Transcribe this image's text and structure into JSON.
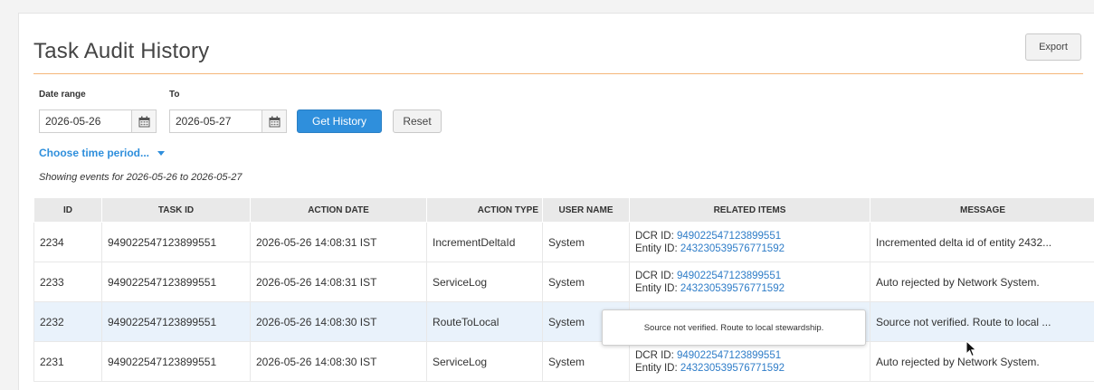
{
  "header": {
    "title": "Task Audit History",
    "export_label": "Export"
  },
  "filters": {
    "date_range_label": "Date range",
    "to_label": "To",
    "from_value": "2026-05-26",
    "to_value": "2026-05-27",
    "calendar_icon": "calendar-icon",
    "get_history_label": "Get History",
    "reset_label": "Reset",
    "choose_period_label": "Choose time period...",
    "showing_text": "Showing events for 2026-05-26 to 2026-05-27"
  },
  "colors": {
    "accent": "#2f8fdc",
    "rule": "#f5b77a",
    "highlight_row": "#e9f2fb"
  },
  "table": {
    "columns": [
      "ID",
      "TASK ID",
      "ACTION DATE",
      "ACTION TYPE",
      "USER NAME",
      "RELATED ITEMS",
      "MESSAGE"
    ],
    "rows": [
      {
        "id": "2234",
        "task_id": "949022547123899551",
        "action_date": "2026-05-26 14:08:31 IST",
        "action_type": "IncrementDeltaId",
        "user": "System",
        "dcr_label": "DCR ID: ",
        "dcr": "949022547123899551",
        "entity_label": "Entity ID: ",
        "entity": "243230539576771592",
        "message": "Incremented delta id of entity 2432..."
      },
      {
        "id": "2233",
        "task_id": "949022547123899551",
        "action_date": "2026-05-26 14:08:31 IST",
        "action_type": "ServiceLog",
        "user": "System",
        "dcr_label": "DCR ID: ",
        "dcr": "949022547123899551",
        "entity_label": "Entity ID: ",
        "entity": "243230539576771592",
        "message": "Auto rejected by Network System."
      },
      {
        "id": "2232",
        "task_id": "949022547123899551",
        "action_date": "2026-05-26 14:08:30 IST",
        "action_type": "RouteToLocal",
        "user": "System",
        "message": "Source not verified. Route to local ..."
      },
      {
        "id": "2231",
        "task_id": "949022547123899551",
        "action_date": "2026-05-26 14:08:30 IST",
        "action_type": "ServiceLog",
        "user": "System",
        "dcr_label": "DCR ID: ",
        "dcr": "949022547123899551",
        "entity_label": "Entity ID: ",
        "entity": "243230539576771592",
        "message": "Auto rejected by Network System."
      }
    ]
  },
  "tooltip": {
    "text": "Source not verified. Route to local stewardship."
  }
}
